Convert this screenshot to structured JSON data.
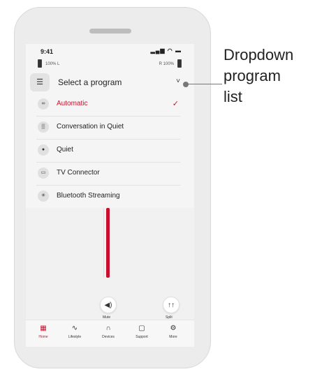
{
  "status": {
    "time": "9:41",
    "signal_icons": "▂▄▆ ◠ ▬"
  },
  "battery": {
    "left_text": "100% L",
    "right_text": "R 100%"
  },
  "dropdown": {
    "icon": "☰",
    "title": "Select a program",
    "chevron": "˅"
  },
  "programs": [
    {
      "icon": "∞",
      "label": "Automatic",
      "selected": true,
      "check": "✓"
    },
    {
      "icon": "▒",
      "label": "Conversation in Quiet"
    },
    {
      "icon": "●",
      "label": "Quiet"
    },
    {
      "icon": "▭",
      "label": "TV Connector"
    },
    {
      "icon": "✳",
      "label": "Bluetooth Streaming"
    }
  ],
  "controls": {
    "mute_icon": "◀)",
    "mute_label": "Mute",
    "split_icon": "↑↑",
    "split_label": "Split",
    "volume_level": 1.0
  },
  "tabs": [
    {
      "icon": "▦",
      "label": "Home",
      "active": true
    },
    {
      "icon": "∿",
      "label": "Lifestyle"
    },
    {
      "icon": "∩",
      "label": "Devices"
    },
    {
      "icon": "▢",
      "label": "Support"
    },
    {
      "icon": "⚙",
      "label": "More"
    }
  ],
  "callout": {
    "line1": "Dropdown",
    "line2": "program",
    "line3": "list"
  },
  "colors": {
    "accent": "#c8102e",
    "screen_bg": "#f5f5f5",
    "phone_bg": "#ececec"
  }
}
